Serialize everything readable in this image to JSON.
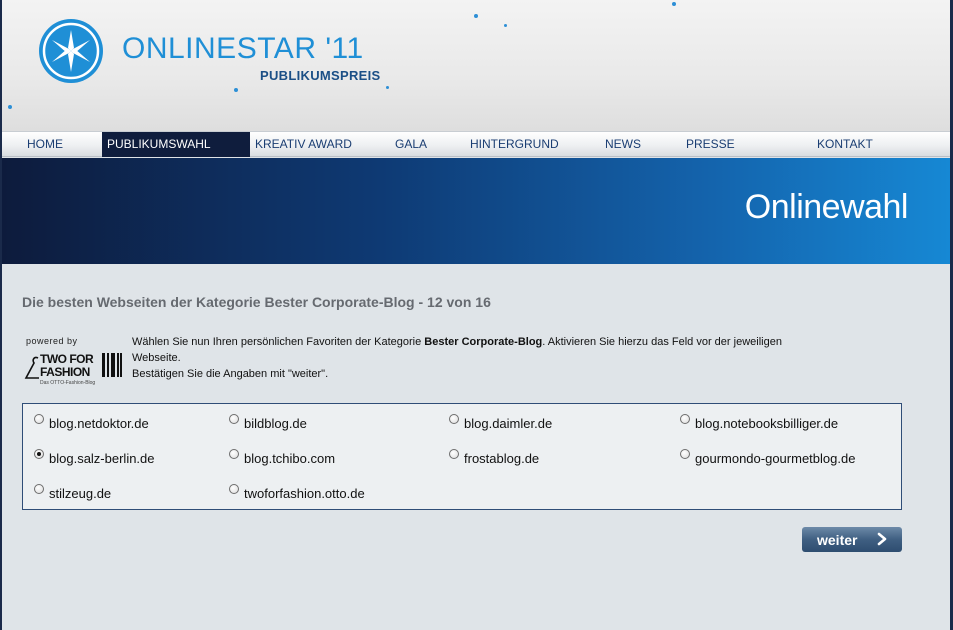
{
  "header": {
    "brand_name": "ONLINESTAR '11",
    "brand_sub": "PUBLIKUMSPREIS"
  },
  "nav": {
    "items": [
      {
        "label": "HOME",
        "active": false
      },
      {
        "label": "PUBLIKUMSWAHL",
        "active": true
      },
      {
        "label": "KREATIV AWARD",
        "active": false
      },
      {
        "label": "GALA",
        "active": false
      },
      {
        "label": "HINTERGRUND",
        "active": false
      },
      {
        "label": "NEWS",
        "active": false
      },
      {
        "label": "PRESSE",
        "active": false
      },
      {
        "label": "KONTAKT",
        "active": false
      }
    ]
  },
  "banner": {
    "title": "Onlinewahl"
  },
  "main": {
    "heading": "Die besten Webseiten der Kategorie Bester Corporate-Blog - 12 von 16",
    "powered_by": "powered by",
    "sponsor_logo_text_1": "TWO FOR",
    "sponsor_logo_text_2": "FASHION",
    "sponsor_logo_sub": "Das OTTO-Fashion-Blog",
    "instructions": {
      "part1": "Wählen Sie nun Ihren persönlichen Favoriten der Kategorie ",
      "category": "Bester Corporate-Blog",
      "part2": ". Aktivieren Sie hierzu das Feld vor der jeweiligen Webseite.",
      "line2": "Bestätigen Sie die Angaben mit \"weiter\"."
    },
    "choices": [
      {
        "label": "blog.netdoktor.de",
        "checked": false
      },
      {
        "label": "bildblog.de",
        "checked": false
      },
      {
        "label": "blog.daimler.de",
        "checked": false
      },
      {
        "label": "blog.notebooksbilliger.de",
        "checked": false
      },
      {
        "label": "blog.salz-berlin.de",
        "checked": true
      },
      {
        "label": "blog.tchibo.com",
        "checked": false
      },
      {
        "label": "frostablog.de",
        "checked": false
      },
      {
        "label": "gourmondo-gourmetblog.de",
        "checked": false
      },
      {
        "label": "stilzeug.de",
        "checked": false
      },
      {
        "label": "twoforfashion.otto.de",
        "checked": false
      }
    ],
    "submit_label": "weiter",
    "submit_icon": "chevron-right-icon"
  },
  "colors": {
    "accent": "#1f8fd6",
    "nav_active_bg": "#0f1d3d",
    "nav_text": "#1a3d72",
    "banner_start": "#0d1b3c",
    "banner_end": "#1688d4"
  }
}
